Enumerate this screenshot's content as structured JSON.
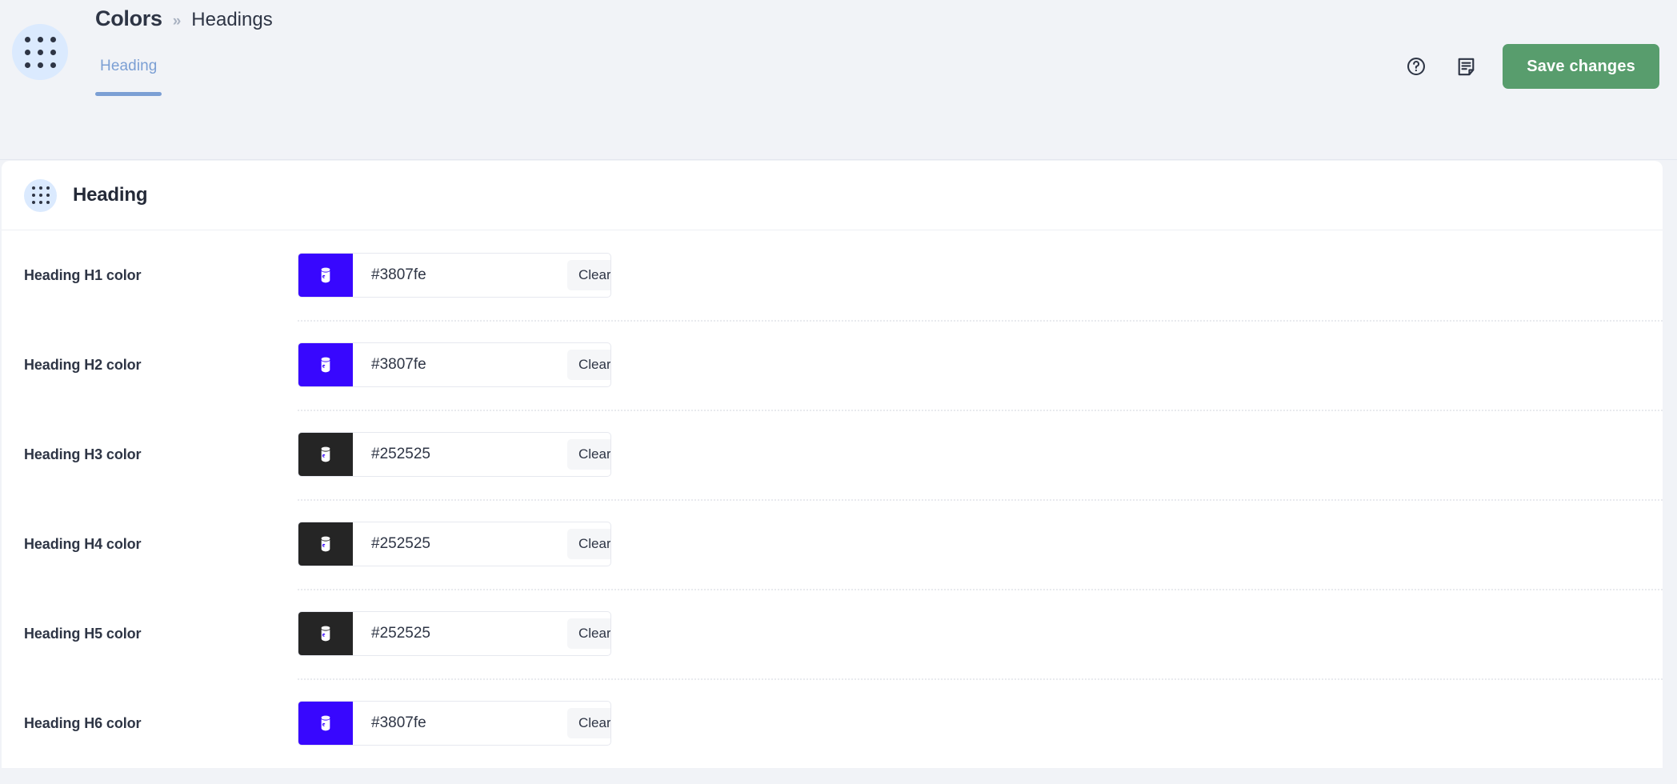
{
  "header": {
    "launcher_icon": "grid-dots-icon",
    "breadcrumb": {
      "root": "Colors",
      "separator": "»",
      "current": "Headings"
    },
    "tabs": [
      {
        "label": "Heading",
        "active": true
      }
    ],
    "actions": {
      "help_icon": "question-circle-icon",
      "notes_icon": "document-note-icon",
      "save_label": "Save changes",
      "save_color": "#589d6d"
    }
  },
  "card": {
    "icon": "grid-dots-icon",
    "title": "Heading",
    "clear_label": "Clear",
    "swatch_icon": "paint-bucket-icon",
    "rows": [
      {
        "label": "Heading H1 color",
        "value": "#3807fe",
        "swatch": "#3807fe"
      },
      {
        "label": "Heading H2 color",
        "value": "#3807fe",
        "swatch": "#3807fe"
      },
      {
        "label": "Heading H3 color",
        "value": "#252525",
        "swatch": "#252525"
      },
      {
        "label": "Heading H4 color",
        "value": "#252525",
        "swatch": "#252525"
      },
      {
        "label": "Heading H5 color",
        "value": "#252525",
        "swatch": "#252525"
      },
      {
        "label": "Heading H6 color",
        "value": "#3807fe",
        "swatch": "#3807fe"
      }
    ]
  },
  "theme": {
    "page_bg": "#f1f3f7",
    "card_bg": "#ffffff",
    "accent_blue": "#7b9fd4",
    "launcher_bg": "#dbeafe",
    "text": "#2e3545"
  }
}
